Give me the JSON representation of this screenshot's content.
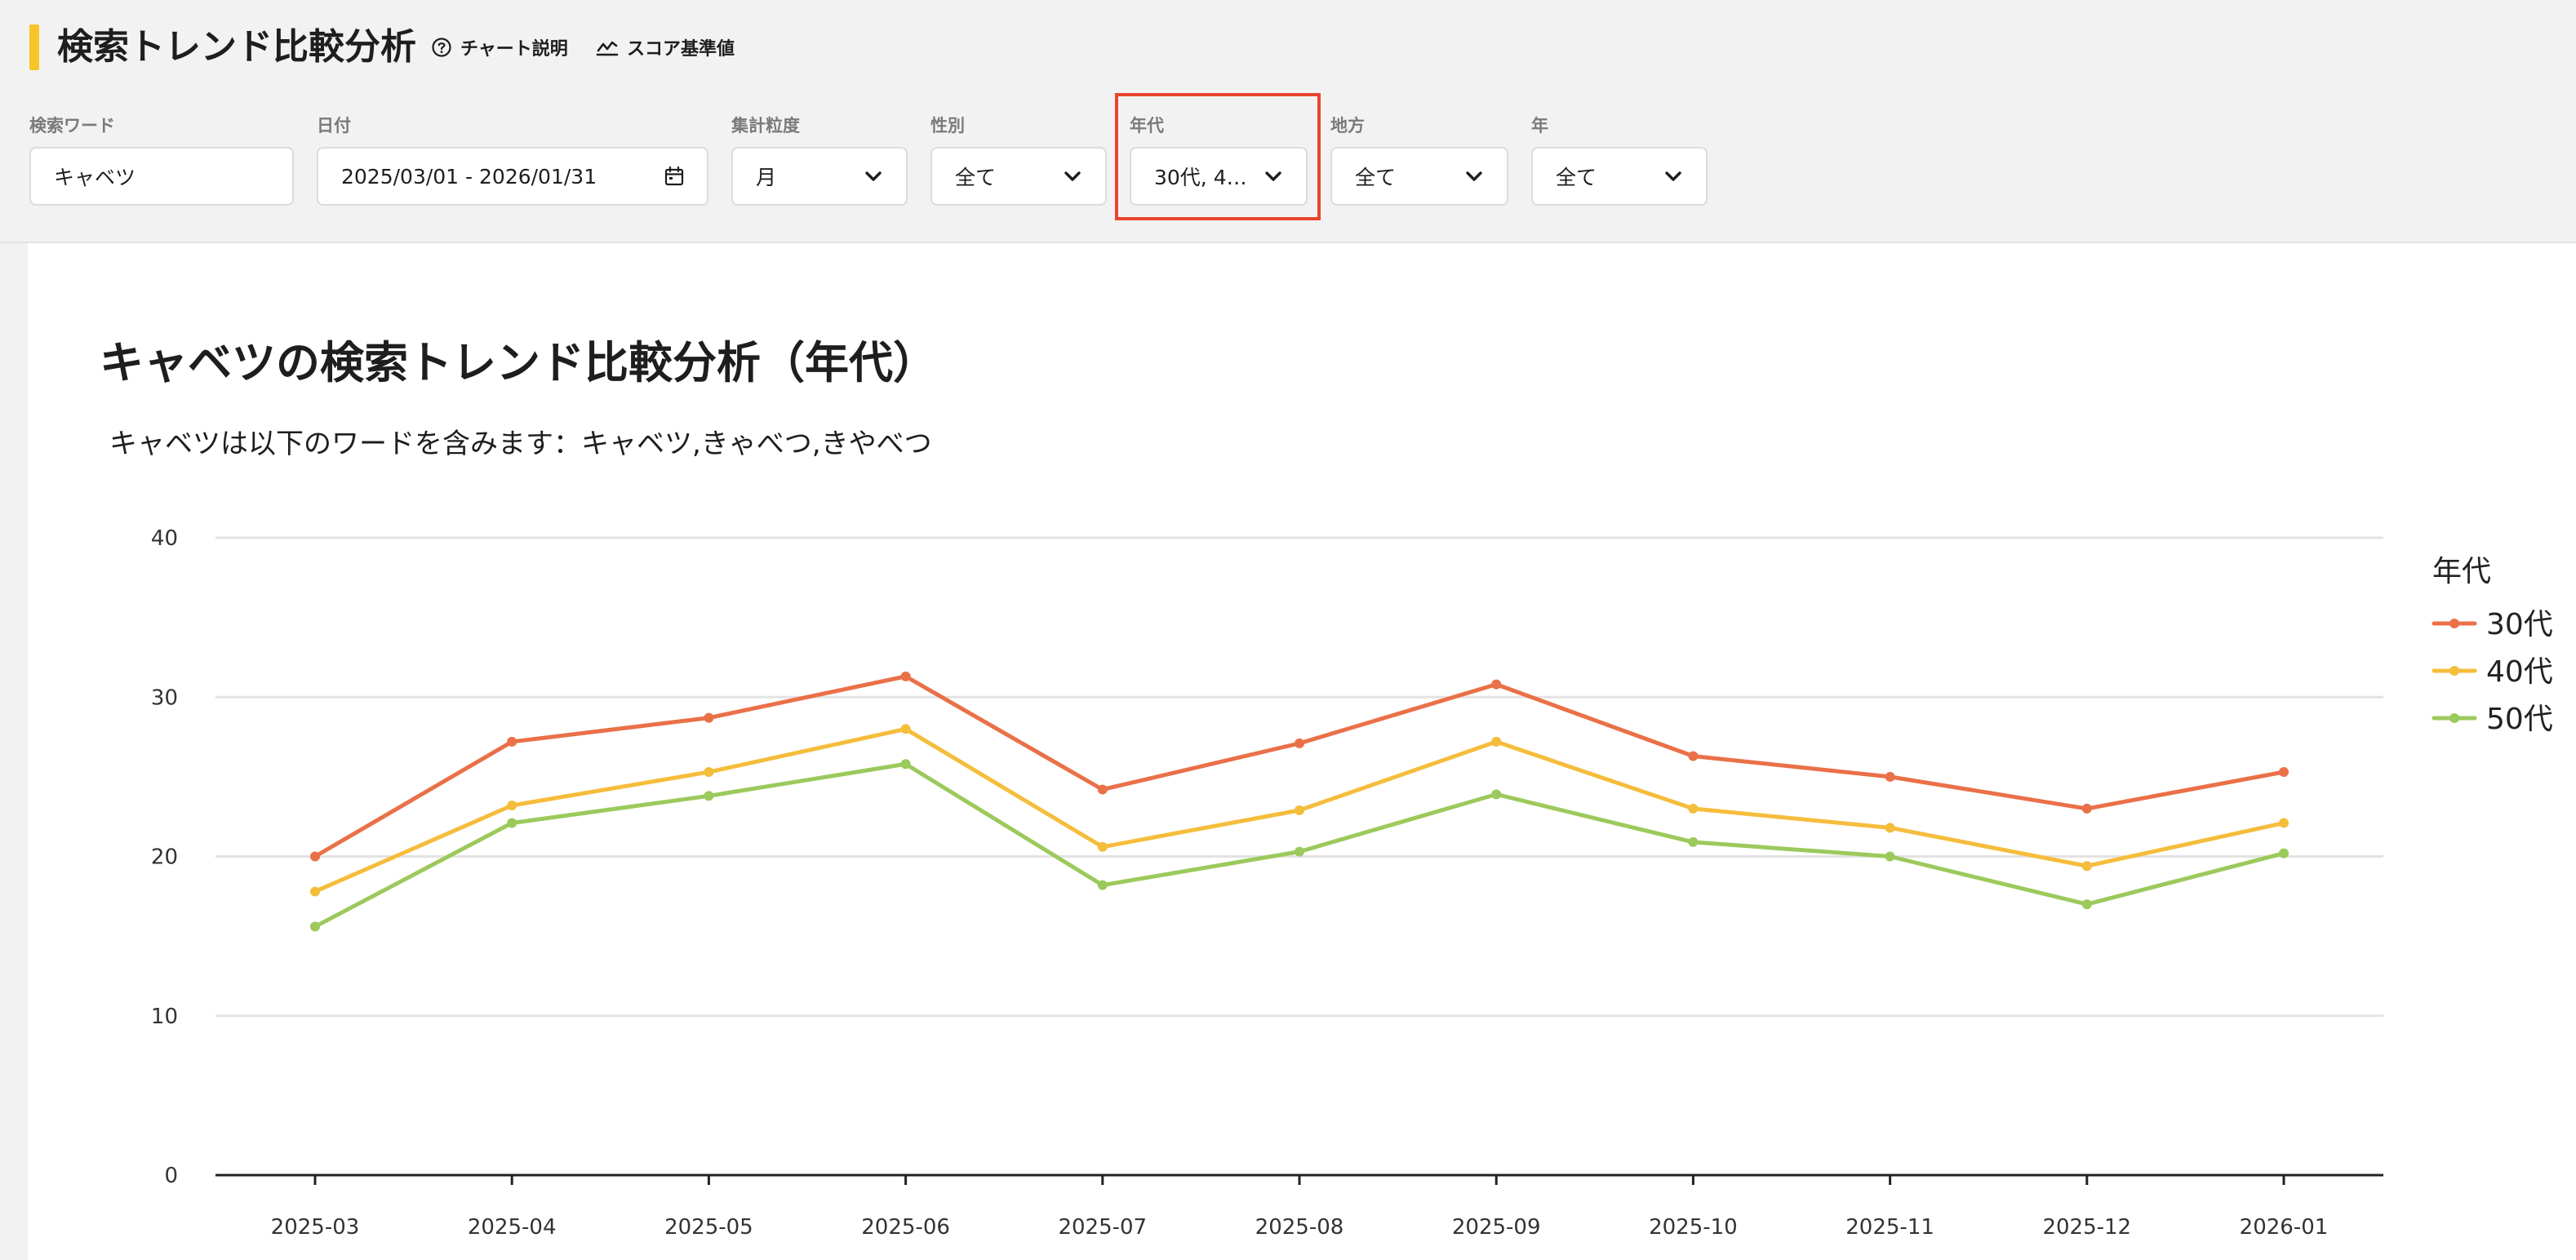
{
  "header": {
    "title": "検索トレンド比較分析",
    "chart_help_label": "チャート説明",
    "score_baseline_label": "スコア基準値",
    "accent_color": "#f7c52a"
  },
  "filters": {
    "keyword": {
      "label": "検索ワード",
      "value": "キャベツ"
    },
    "date": {
      "label": "日付",
      "value": "2025/03/01 - 2026/01/31"
    },
    "granularity": {
      "label": "集計粒度",
      "value": "月"
    },
    "gender": {
      "label": "性別",
      "value": "全て"
    },
    "age": {
      "label": "年代",
      "value": "30代, 4…",
      "highlighted": true,
      "highlight_color": "#e8452c"
    },
    "region": {
      "label": "地方",
      "value": "全て"
    },
    "year": {
      "label": "年",
      "value": "全て"
    }
  },
  "chart": {
    "title": "キャベツの検索トレンド比較分析（年代）",
    "subtitle": "キャベツは以下のワードを含みます：キャベツ,きゃべつ,きやべつ"
  },
  "chart_data": {
    "type": "line",
    "title": "キャベツの検索トレンド比較分析（年代）",
    "x": [
      "2025-03",
      "2025-04",
      "2025-05",
      "2025-06",
      "2025-07",
      "2025-08",
      "2025-09",
      "2025-10",
      "2025-11",
      "2025-12",
      "2026-01"
    ],
    "ylim": [
      0,
      40
    ],
    "yticks": [
      0,
      10,
      20,
      30,
      40
    ],
    "grid": true,
    "legend_title": "年代",
    "legend_position": "right",
    "series": [
      {
        "name": "30代",
        "color": "#ea7048",
        "values": [
          20.0,
          27.2,
          28.7,
          31.3,
          24.2,
          27.1,
          30.8,
          26.3,
          25.0,
          23.0,
          25.3
        ]
      },
      {
        "name": "40代",
        "color": "#f5bd3c",
        "values": [
          17.8,
          23.2,
          25.3,
          28.0,
          20.6,
          22.9,
          27.2,
          23.0,
          21.8,
          19.4,
          22.1
        ]
      },
      {
        "name": "50代",
        "color": "#9cc95c",
        "values": [
          15.6,
          22.1,
          23.8,
          25.8,
          18.2,
          20.3,
          23.9,
          20.9,
          20.0,
          17.0,
          20.2
        ]
      }
    ]
  }
}
